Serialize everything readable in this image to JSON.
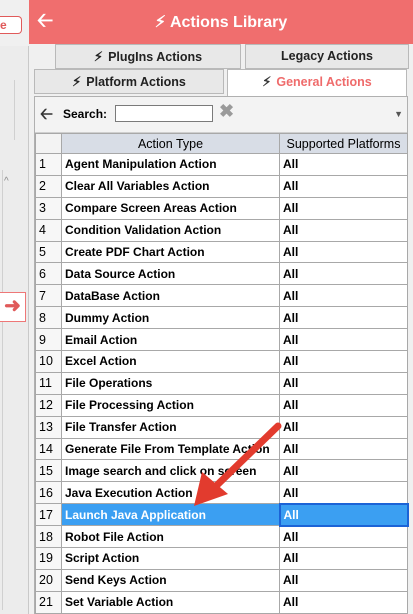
{
  "left_window": {
    "pill_text": "e",
    "arrow_glyph": "➜"
  },
  "header": {
    "back_icon": "arrow-left-icon",
    "title": "Actions Library",
    "title_icon": "bolt-icon",
    "accent_color": "#f06e6e"
  },
  "tabs": [
    {
      "label": "PlugIns Actions",
      "icon": "bolt-plugin-icon",
      "active": false
    },
    {
      "label": "Legacy Actions",
      "icon": "",
      "active": false
    },
    {
      "label": "Platform Actions",
      "icon": "bolt-platform-icon",
      "active": false
    },
    {
      "label": "General Actions",
      "icon": "bolt-general-icon",
      "active": true
    }
  ],
  "search": {
    "label": "Search:",
    "value": "",
    "clear_icon": "clear-x-icon"
  },
  "table": {
    "columns": [
      "Action Type",
      "Supported Platforms"
    ],
    "rows": [
      {
        "num": "1",
        "type": "Agent Manipulation Action",
        "platforms": "All"
      },
      {
        "num": "2",
        "type": "Clear All Variables Action",
        "platforms": "All"
      },
      {
        "num": "3",
        "type": "Compare Screen Areas Action",
        "platforms": "All"
      },
      {
        "num": "4",
        "type": "Condition Validation Action",
        "platforms": "All"
      },
      {
        "num": "5",
        "type": "Create PDF Chart Action",
        "platforms": "All"
      },
      {
        "num": "6",
        "type": "Data Source Action",
        "platforms": "All"
      },
      {
        "num": "7",
        "type": "DataBase Action",
        "platforms": "All"
      },
      {
        "num": "8",
        "type": "Dummy Action",
        "platforms": "All"
      },
      {
        "num": "9",
        "type": "Email Action",
        "platforms": "All"
      },
      {
        "num": "10",
        "type": "Excel Action",
        "platforms": "All"
      },
      {
        "num": "11",
        "type": "File Operations",
        "platforms": "All"
      },
      {
        "num": "12",
        "type": "File Processing Action",
        "platforms": "All"
      },
      {
        "num": "13",
        "type": "File Transfer Action",
        "platforms": "All"
      },
      {
        "num": "14",
        "type": "Generate File From Template Action",
        "platforms": "All"
      },
      {
        "num": "15",
        "type": "Image search and click on screen",
        "platforms": "All"
      },
      {
        "num": "16",
        "type": "Java Execution Action",
        "platforms": "All"
      },
      {
        "num": "17",
        "type": "Launch Java Application",
        "platforms": "All",
        "selected": true
      },
      {
        "num": "18",
        "type": "Robot File Action",
        "platforms": "All"
      },
      {
        "num": "19",
        "type": "Script Action",
        "platforms": "All"
      },
      {
        "num": "20",
        "type": "Send Keys Action",
        "platforms": "All"
      },
      {
        "num": "21",
        "type": "Set Variable Action",
        "platforms": "All"
      }
    ],
    "selected_color": "#3b9ff2"
  }
}
